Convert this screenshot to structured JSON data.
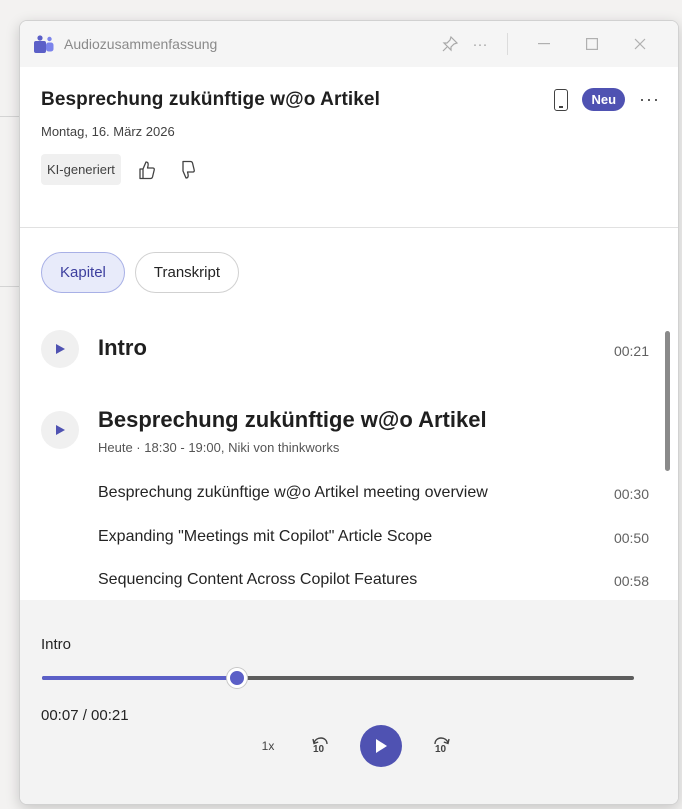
{
  "window": {
    "title": "Audiozusammenfassung"
  },
  "header": {
    "meeting_title": "Besprechung zukünftige w@o Artikel",
    "date": "Montag, 16. März 2026",
    "badge": "Neu",
    "more": "···",
    "ai_tag": "KI-generiert"
  },
  "tabs": [
    {
      "label": "Kapitel",
      "active": true
    },
    {
      "label": "Transkript",
      "active": false
    }
  ],
  "chapters": [
    {
      "title": "Intro",
      "time": "00:21"
    },
    {
      "title": "Besprechung zukünftige w@o Artikel",
      "subtitle": "Heute · 18:30 - 19:00, Niki von thinkworks"
    }
  ],
  "sub_items": [
    {
      "label": "Besprechung zukünftige w@o Artikel meeting overview",
      "time": "00:30"
    },
    {
      "label": "Expanding \"Meetings mit Copilot\" Article Scope",
      "time": "00:50"
    },
    {
      "label": "Sequencing Content Across Copilot Features",
      "time": "00:58"
    }
  ],
  "player": {
    "current_chapter": "Intro",
    "time_readout": "00:07 / 00:21",
    "progress": 0.33,
    "speed": "1x",
    "skip_back": "10",
    "skip_forward": "10"
  },
  "colors": {
    "accent": "#4f52b2",
    "tab_active_bg": "#e8ebfa"
  }
}
